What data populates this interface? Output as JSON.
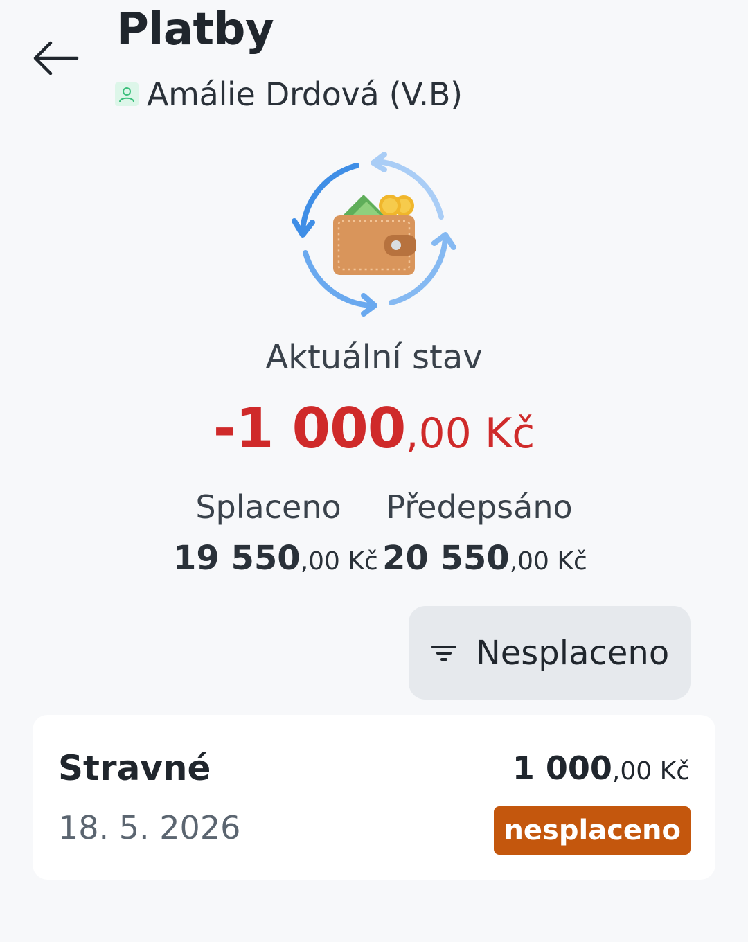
{
  "header": {
    "title": "Platby",
    "person": "Amálie Drdová (V.B)"
  },
  "summary": {
    "status_label": "Aktuální stav",
    "balance_main": "-1 000",
    "balance_decimal": ",00 Kč",
    "paid_label": "Splaceno",
    "paid_main": "19 550",
    "paid_decimal": ",00 Kč",
    "prescribed_label": "Předepsáno",
    "prescribed_main": "20 550",
    "prescribed_decimal": ",00 Kč"
  },
  "filter": {
    "label": "Nesplaceno"
  },
  "payments": [
    {
      "title": "Stravné",
      "date": "18. 5. 2026",
      "amount_main": "1 000",
      "amount_decimal": ",00 Kč",
      "status": "nesplaceno"
    }
  ],
  "colors": {
    "negative": "#cf2a2a",
    "badge_unpaid": "#c4570d",
    "background": "#f7f8fa"
  },
  "icons": {
    "back": "arrow-left-icon",
    "person": "person-icon",
    "wallet": "wallet-refresh-icon",
    "filter": "filter-icon"
  }
}
